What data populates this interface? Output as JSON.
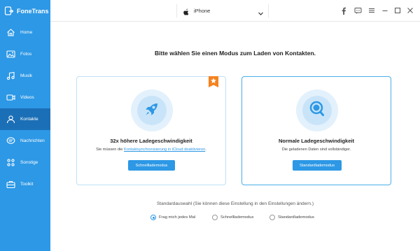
{
  "app": {
    "title": "FoneTrans"
  },
  "device": {
    "name": "iPhone"
  },
  "titlebar_icons": [
    "facebook-icon",
    "chat-icon",
    "menu-icon",
    "minimize-icon",
    "maximize-icon",
    "close-icon"
  ],
  "sidebar": {
    "items": [
      {
        "label": "Home",
        "icon": "home-icon"
      },
      {
        "label": "Fotos",
        "icon": "photos-icon"
      },
      {
        "label": "Musik",
        "icon": "music-icon"
      },
      {
        "label": "Videos",
        "icon": "video-icon"
      },
      {
        "label": "Kontakte",
        "icon": "contacts-icon",
        "active": true
      },
      {
        "label": "Nachrichten",
        "icon": "messages-icon"
      },
      {
        "label": "Sonstige",
        "icon": "other-icon"
      },
      {
        "label": "Toolkit",
        "icon": "toolkit-icon"
      }
    ]
  },
  "main": {
    "heading": "Bitte wählen Sie einen Modus zum Laden von Kontakten.",
    "fast_card": {
      "title": "32x höhere Ladegeschwindigkeit",
      "desc_prefix": "Sie müssen die ",
      "desc_link": "Kontaktsynchronisierung in iCloud deaktivieren",
      "desc_suffix": ".",
      "button": "Schnelllademodus",
      "icon": "rocket-icon",
      "badge_icon": "star-badge-icon"
    },
    "normal_card": {
      "title": "Normale Ladegeschwindigkeit",
      "desc": "Die geladenen Daten sind vollständiger.",
      "button": "Standardlademodus",
      "icon": "magnifier-icon"
    },
    "default_label": "Standardauswahl (Sie können diese Einstellung in den Einstellungen ändern.)",
    "radio_options": [
      {
        "label": "Frag mich jedes Mal",
        "checked": true
      },
      {
        "label": "Schnelllademodus",
        "checked": false
      },
      {
        "label": "Standardlademodus",
        "checked": false
      }
    ]
  },
  "colors": {
    "accent": "#2d98e5",
    "sidebar_active": "#1b6fb6",
    "badge": "#f5821f"
  }
}
